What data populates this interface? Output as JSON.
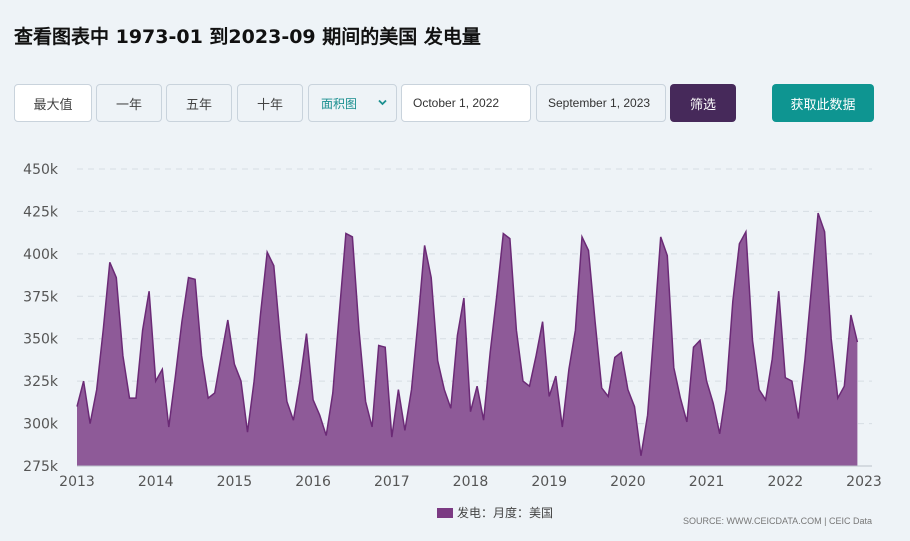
{
  "page": {
    "title": "查看图表中 1973-01 到2023-09 期间的美国 发电量"
  },
  "toolbar": {
    "range_buttons": [
      "最大值",
      "一年",
      "五年",
      "十年"
    ],
    "chart_type_selected": "面积图",
    "date_from": "October 1, 2022",
    "date_to": "September 1, 2023",
    "filter_label": "筛选",
    "get_data_label": "获取此数据"
  },
  "legend": {
    "label": "发电：月度：美国"
  },
  "source": {
    "text": "SOURCE: WWW.CEICDATA.COM | CEIC Data"
  },
  "colors": {
    "series_fill": "#8e5a98",
    "series_line": "#6b2a76",
    "filter_button": "#46295a",
    "get_data_button": "#0e9591"
  },
  "icons": {
    "select_arrow": "chevron-down-icon"
  },
  "chart_data": {
    "type": "area",
    "x_start": "2013-01",
    "x_end": "2023-09",
    "x_frequency": "monthly",
    "x_tick_labels": [
      "2013",
      "2014",
      "2015",
      "2016",
      "2017",
      "2018",
      "2019",
      "2020",
      "2021",
      "2022",
      "2023"
    ],
    "y_tick_labels": [
      "275k",
      "300k",
      "325k",
      "350k",
      "375k",
      "400k",
      "425k",
      "450k"
    ],
    "ylim": [
      275000,
      450000
    ],
    "grid": true,
    "legend_position": "bottom-center",
    "series": [
      {
        "name": "发电：月度：美国",
        "values": [
          310000,
          325000,
          300000,
          320000,
          355000,
          395000,
          386000,
          340000,
          315000,
          315000,
          355000,
          378000,
          325000,
          332000,
          298000,
          328000,
          360000,
          386000,
          385000,
          340000,
          315000,
          318000,
          340000,
          361000,
          335000,
          325000,
          295000,
          325000,
          365000,
          401000,
          393000,
          350000,
          313000,
          302000,
          325000,
          353000,
          314000,
          305000,
          293000,
          318000,
          365000,
          412000,
          410000,
          355000,
          313000,
          298000,
          346000,
          345000,
          292000,
          320000,
          296000,
          320000,
          360000,
          405000,
          386000,
          337000,
          320000,
          309000,
          352000,
          374000,
          307000,
          322000,
          302000,
          342000,
          375000,
          412000,
          409000,
          355000,
          325000,
          322000,
          340000,
          360000,
          316000,
          328000,
          298000,
          332000,
          355000,
          410000,
          402000,
          360000,
          321000,
          316000,
          339000,
          342000,
          320000,
          310000,
          281000,
          305000,
          356000,
          410000,
          399000,
          333000,
          315000,
          301000,
          345000,
          349000,
          325000,
          312000,
          294000,
          320000,
          372000,
          406000,
          413000,
          349000,
          320000,
          314000,
          338000,
          378000,
          327000,
          325000,
          303000,
          338000,
          380000,
          424000,
          413000,
          350000,
          315000,
          322000,
          364000,
          348000
        ]
      }
    ]
  }
}
